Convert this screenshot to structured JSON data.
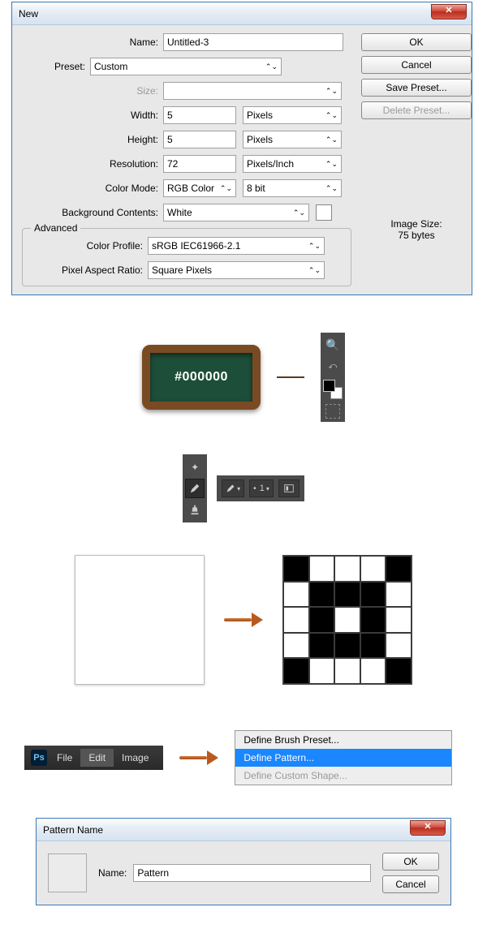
{
  "new_dialog": {
    "title": "New",
    "name_label": "Name:",
    "name_value": "Untitled-3",
    "preset_label": "Preset:",
    "preset_value": "Custom",
    "size_label": "Size:",
    "size_value": "",
    "width_label": "Width:",
    "width_value": "5",
    "width_unit": "Pixels",
    "height_label": "Height:",
    "height_value": "5",
    "height_unit": "Pixels",
    "res_label": "Resolution:",
    "res_value": "72",
    "res_unit": "Pixels/Inch",
    "colormode_label": "Color Mode:",
    "colormode_value": "RGB Color",
    "colormode_depth": "8 bit",
    "bgcontents_label": "Background Contents:",
    "bgcontents_value": "White",
    "advanced_legend": "Advanced",
    "colorprofile_label": "Color Profile:",
    "colorprofile_value": "sRGB IEC61966-2.1",
    "par_label": "Pixel Aspect Ratio:",
    "par_value": "Square Pixels",
    "btn_ok": "OK",
    "btn_cancel": "Cancel",
    "btn_savepreset": "Save Preset...",
    "btn_deletepreset": "Delete Preset...",
    "image_size_label": "Image Size:",
    "image_size_value": "75 bytes"
  },
  "chalkboard": {
    "hex": "#000000"
  },
  "pencil_options": {
    "size_value": "1"
  },
  "menubar": {
    "logo": "Ps",
    "items": [
      "File",
      "Edit",
      "Image"
    ],
    "selected_index": 1
  },
  "edit_menu": {
    "items": [
      {
        "label": "Define Brush Preset...",
        "disabled": false,
        "selected": false
      },
      {
        "label": "Define Pattern...",
        "disabled": false,
        "selected": true
      },
      {
        "label": "Define Custom Shape...",
        "disabled": true,
        "selected": false
      }
    ]
  },
  "pattern_dialog": {
    "title": "Pattern Name",
    "name_label": "Name:",
    "name_value": "Pattern",
    "btn_ok": "OK",
    "btn_cancel": "Cancel"
  },
  "pattern_grid": {
    "cells": [
      "b",
      "w",
      "w",
      "w",
      "b",
      "w",
      "b",
      "b",
      "b",
      "w",
      "w",
      "b",
      "w",
      "b",
      "w",
      "w",
      "b",
      "b",
      "b",
      "w",
      "b",
      "w",
      "w",
      "w",
      "b"
    ]
  }
}
